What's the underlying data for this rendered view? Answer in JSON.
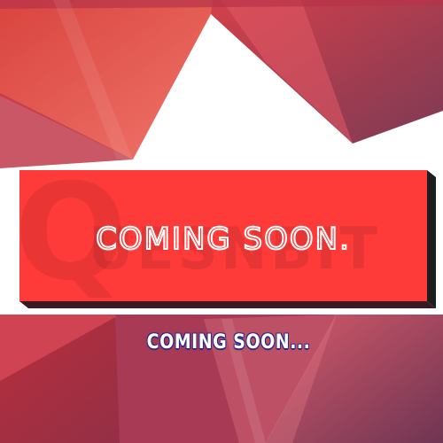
{
  "banner": {
    "headline": "COMING SOON.",
    "watermark_letter": "Q",
    "watermark_text": "UESNBIT"
  },
  "subtitle": "COMING SOON...",
  "colors": {
    "banner_red": "#fe3b38",
    "banner_shadow": "#1d1d1d",
    "subtitle_outline": "#2b2a8a",
    "background_top_left": "#e35a55",
    "background_dark": "#8f3a4f"
  }
}
